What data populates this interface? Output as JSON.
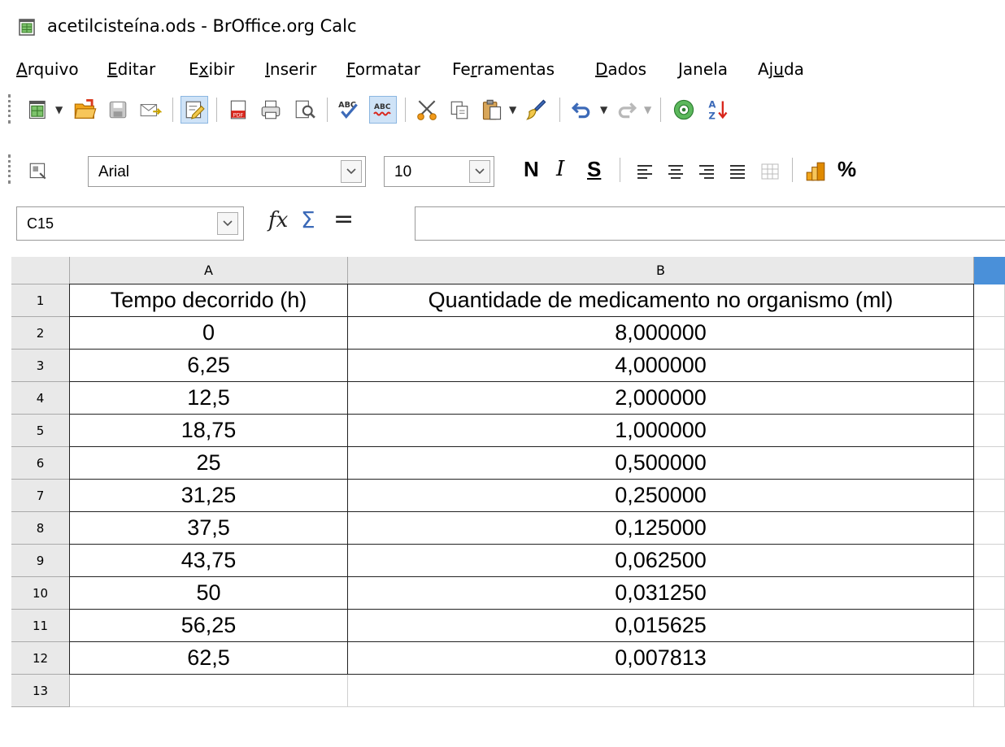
{
  "window": {
    "title": "acetilcisteína.ods - BrOffice.org Calc"
  },
  "menubar": {
    "items": [
      {
        "pre": "",
        "accel": "A",
        "post": "rquivo"
      },
      {
        "pre": "",
        "accel": "E",
        "post": "ditar"
      },
      {
        "pre": "E",
        "accel": "x",
        "post": "ibir"
      },
      {
        "pre": "",
        "accel": "I",
        "post": "nserir"
      },
      {
        "pre": "",
        "accel": "F",
        "post": "ormatar"
      },
      {
        "pre": "Fe",
        "accel": "r",
        "post": "ramentas"
      },
      {
        "pre": "",
        "accel": "D",
        "post": "ados"
      },
      {
        "pre": "",
        "accel": "J",
        "post": "anela"
      },
      {
        "pre": "Aj",
        "accel": "u",
        "post": "da"
      }
    ]
  },
  "formatting": {
    "font_name": "Arial",
    "font_size": "10",
    "bold_label": "N",
    "italic_label": "I",
    "underline_label": "S",
    "percent_label": "%"
  },
  "formula_bar": {
    "cell_reference": "C15",
    "formula": "",
    "equals_label": "="
  },
  "sheet": {
    "column_headers": [
      "A",
      "B"
    ],
    "row_numbers": [
      "1",
      "2",
      "3",
      "4",
      "5",
      "6",
      "7",
      "8",
      "9",
      "10",
      "11",
      "12",
      "13"
    ],
    "rows": [
      [
        "Tempo decorrido (h)",
        "Quantidade de medicamento no organismo (ml)"
      ],
      [
        "0",
        "8,000000"
      ],
      [
        "6,25",
        "4,000000"
      ],
      [
        "12,5",
        "2,000000"
      ],
      [
        "18,75",
        "1,000000"
      ],
      [
        "25",
        "0,500000"
      ],
      [
        "31,25",
        "0,250000"
      ],
      [
        "37,5",
        "0,125000"
      ],
      [
        "43,75",
        "0,062500"
      ],
      [
        "50",
        "0,031250"
      ],
      [
        "56,25",
        "0,015625"
      ],
      [
        "62,5",
        "0,007813"
      ],
      [
        "",
        ""
      ]
    ]
  }
}
